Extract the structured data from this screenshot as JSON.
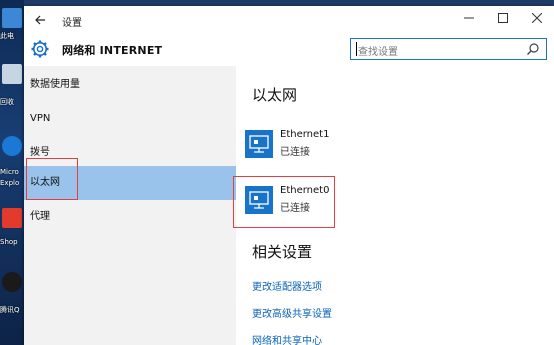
{
  "desktop": {
    "icons": [
      {
        "label": "此电",
        "icon": "computer-icon"
      },
      {
        "label": "回收",
        "icon": "recycle-bin-icon"
      },
      {
        "label": "Micro",
        "icon": "edge-icon"
      },
      {
        "label": "Explo",
        "icon": "edge-icon"
      },
      {
        "label": "Shop",
        "icon": "shop-icon"
      },
      {
        "label": "腾讯Q",
        "icon": "qq-icon"
      }
    ]
  },
  "window": {
    "title": "设置",
    "controls": [
      "minimize",
      "maximize",
      "close"
    ]
  },
  "header": {
    "title": "网络和 INTERNET",
    "search_placeholder": "查找设置"
  },
  "nav": {
    "items": [
      {
        "label": "数据使用量"
      },
      {
        "label": "VPN"
      },
      {
        "label": "拨号"
      },
      {
        "label": "以太网",
        "selected": true
      },
      {
        "label": "代理"
      }
    ]
  },
  "content": {
    "section_title": "以太网",
    "adapters": [
      {
        "name": "Ethernet1",
        "status": "已连接"
      },
      {
        "name": "Ethernet0",
        "status": "已连接"
      }
    ],
    "related_title": "相关设置",
    "related_links": [
      "更改适配器选项",
      "更改高级共享设置",
      "网络和共享中心"
    ]
  },
  "colors": {
    "accent": "#1774c9",
    "nav_selected": "#99c3eb",
    "link": "#0a63b8",
    "highlight_box": "#e04040"
  }
}
